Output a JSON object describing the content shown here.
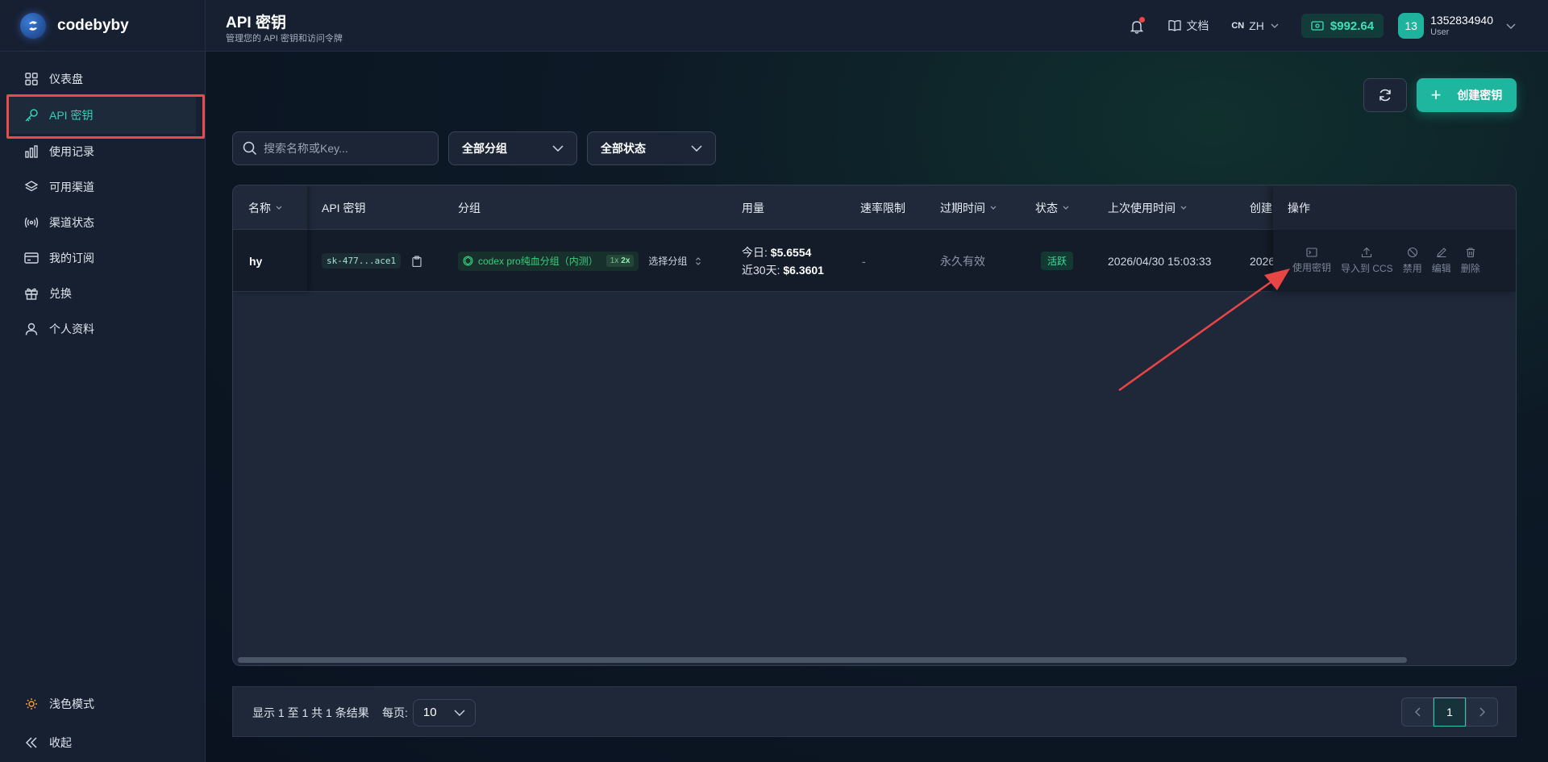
{
  "app": {
    "name": "codebyby"
  },
  "colors": {
    "accent": "#1fb6a0",
    "highlight_box": "#e94b4b",
    "balance": "#3ee0b6",
    "status_active": "#3ee0a0"
  },
  "sidebar": {
    "items": [
      {
        "label": "仪表盘",
        "icon": "grid-icon"
      },
      {
        "label": "API 密钥",
        "icon": "key-icon",
        "active": true
      },
      {
        "label": "使用记录",
        "icon": "bar-chart-icon"
      },
      {
        "label": "可用渠道",
        "icon": "layers-icon"
      },
      {
        "label": "渠道状态",
        "icon": "broadcast-icon"
      },
      {
        "label": "我的订阅",
        "icon": "card-icon"
      },
      {
        "label": "兑换",
        "icon": "gift-icon"
      },
      {
        "label": "个人资料",
        "icon": "user-icon"
      }
    ],
    "theme_toggle": "浅色模式",
    "collapse": "收起"
  },
  "header": {
    "title": "API 密钥",
    "subtitle": "管理您的 API 密钥和访问令牌",
    "docs": "文档",
    "lang_code": "CN",
    "lang": "ZH",
    "balance": "$992.64",
    "avatar_text": "13",
    "username": "1352834940",
    "role": "User"
  },
  "toolbar": {
    "create_label": "创建密钥"
  },
  "filters": {
    "search_placeholder": "搜索名称或Key...",
    "group_select": "全部分组",
    "status_select": "全部状态"
  },
  "table": {
    "headers": {
      "name": "名称",
      "key": "API 密钥",
      "group": "分组",
      "usage": "用量",
      "rate": "速率限制",
      "expire": "过期时间",
      "status": "状态",
      "last_used": "上次使用时间",
      "created": "创建",
      "actions": "操作"
    },
    "rows": [
      {
        "name": "hy",
        "key": "sk-477...ace1",
        "group": "codex pro纯血分组（内测）",
        "multiplier": "2x",
        "multiplier_prefix": "1x",
        "select_group": "选择分组",
        "usage_today_label": "今日:",
        "usage_today": "$5.6554",
        "usage_30d_label": "近30天:",
        "usage_30d": "$6.3601",
        "rate": "-",
        "expire": "永久有效",
        "status": "活跃",
        "last_used": "2026/04/30 15:03:33",
        "created": "2026"
      }
    ],
    "actions": [
      "使用密钥",
      "导入到 CCS",
      "禁用",
      "编辑",
      "删除"
    ]
  },
  "pagination": {
    "summary": "显示 1 至 1 共 1 条结果",
    "per_page_label": "每页:",
    "per_page": "10",
    "current_page": "1"
  }
}
